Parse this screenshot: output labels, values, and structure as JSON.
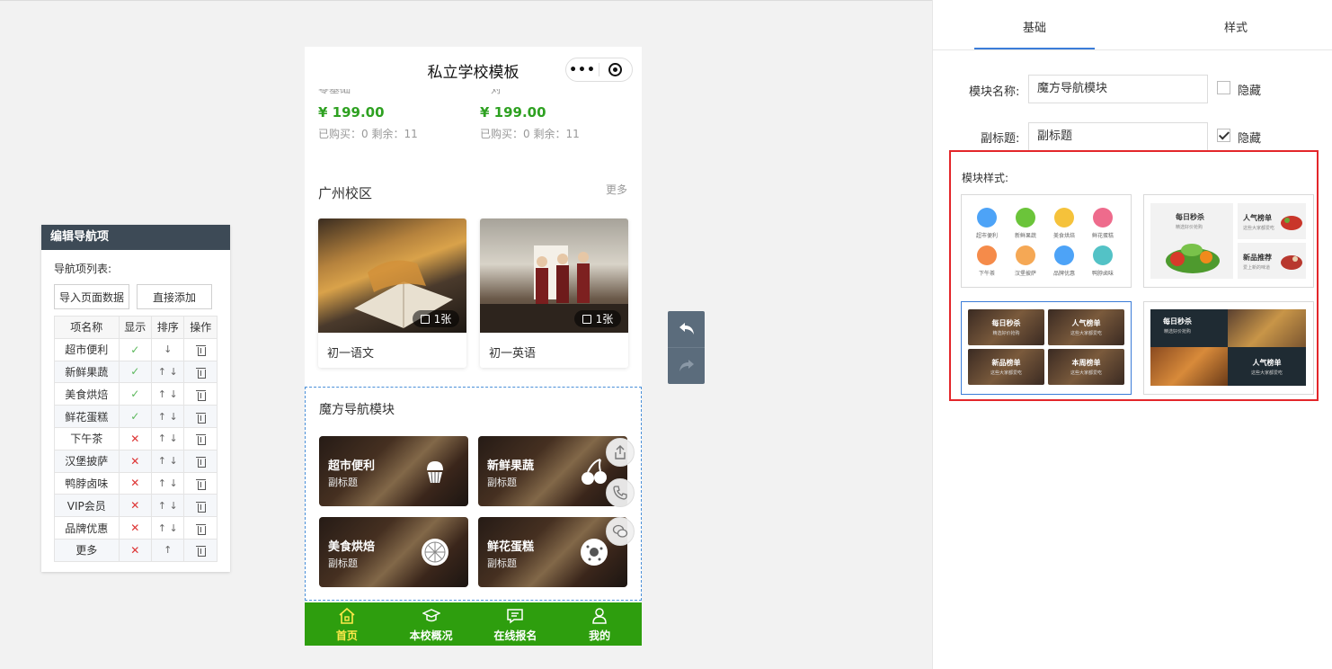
{
  "nav_editor": {
    "title": "编辑导航项",
    "list_label": "导航项列表:",
    "import_btn": "导入页面数据",
    "add_btn": "直接添加",
    "headers": [
      "项名称",
      "显示",
      "排序",
      "操作"
    ],
    "rows": [
      {
        "name": "超市便利",
        "show": "✓",
        "sort": "↓"
      },
      {
        "name": "新鲜果蔬",
        "show": "✓",
        "sort": "↑ ↓"
      },
      {
        "name": "美食烘焙",
        "show": "✓",
        "sort": "↑ ↓"
      },
      {
        "name": "鲜花蛋糕",
        "show": "✓",
        "sort": "↑ ↓"
      },
      {
        "name": "下午茶",
        "show": "✕",
        "sort": "↑ ↓"
      },
      {
        "name": "汉堡披萨",
        "show": "✕",
        "sort": "↑ ↓"
      },
      {
        "name": "鸭脖卤味",
        "show": "✕",
        "sort": "↑ ↓"
      },
      {
        "name": "VIP会员",
        "show": "✕",
        "sort": "↑ ↓"
      },
      {
        "name": "品牌优惠",
        "show": "✕",
        "sort": "↑ ↓"
      },
      {
        "name": "更多",
        "show": "✕",
        "sort": "↑"
      }
    ]
  },
  "phone": {
    "title": "私立学校模板",
    "capsule_dots": "•••",
    "products": [
      {
        "name": "零基础",
        "price": "¥ 199.00",
        "sold": "已购买：0 剩余：11"
      },
      {
        "name": "一对一",
        "price": "¥ 199.00",
        "sold": "已购买：0 剩余：11"
      }
    ],
    "campus": {
      "title": "广州校区",
      "more": "更多",
      "cards": [
        {
          "caption": "初一语文",
          "badge": "1张"
        },
        {
          "caption": "初一英语",
          "badge": "1张"
        }
      ]
    },
    "magic_nav": {
      "title": "魔方导航模块",
      "tiles": [
        {
          "title": "超市便利",
          "subtitle": "副标题",
          "icon": "cupcake-icon"
        },
        {
          "title": "新鲜果蔬",
          "subtitle": "副标题",
          "icon": "cherry-icon"
        },
        {
          "title": "美食烘焙",
          "subtitle": "副标题",
          "icon": "lemon-slice-icon"
        },
        {
          "title": "鲜花蛋糕",
          "subtitle": "副标题",
          "icon": "donut-icon"
        }
      ]
    },
    "tabbar": [
      {
        "label": "首页",
        "icon": "home-icon",
        "active": true
      },
      {
        "label": "本校概况",
        "icon": "graduation-cap-icon",
        "active": false
      },
      {
        "label": "在线报名",
        "icon": "message-icon",
        "active": false
      },
      {
        "label": "我的",
        "icon": "user-icon",
        "active": false
      }
    ],
    "colors": {
      "tabbar": "#2e9e0e",
      "active_tab": "#ffe94a",
      "price": "#2ea121"
    }
  },
  "right_panel": {
    "tabs": [
      "基础",
      "样式"
    ],
    "active_tab": "基础",
    "module_name_label": "模块名称:",
    "module_name_value": "魔方导航模块",
    "subtitle_label": "副标题:",
    "subtitle_value": "副标题",
    "hide_label": "隐藏",
    "hide_name_checked": false,
    "hide_subtitle_checked": true,
    "style_label": "模块样式:",
    "grid_items": [
      "超市便利",
      "新鲜果蔬",
      "美食烘焙",
      "鲜花蛋糕",
      "下午茶",
      "汉堡披萨",
      "品牌优惠",
      "鸭脖卤味"
    ],
    "style2": {
      "main": "每日秒杀",
      "main_sub": "精选好价抢购",
      "a": "人气榜单",
      "a_sub": "这些大家都爱吃",
      "b": "新品推荐",
      "b_sub": "爱上新的味道"
    },
    "style3": {
      "a": "每日秒杀",
      "a_sub": "精选好价抢购",
      "b": "人气榜单",
      "b_sub": "这些大家都爱吃",
      "c": "新品榜单",
      "c_sub": "这些大家都爱吃",
      "d": "本周榜单",
      "d_sub": "这些大家都爱吃"
    },
    "style4": {
      "a": "每日秒杀",
      "a_sub": "精选好价抢购",
      "b": "人气榜单",
      "b_sub": "这些大家都爱吃"
    }
  }
}
